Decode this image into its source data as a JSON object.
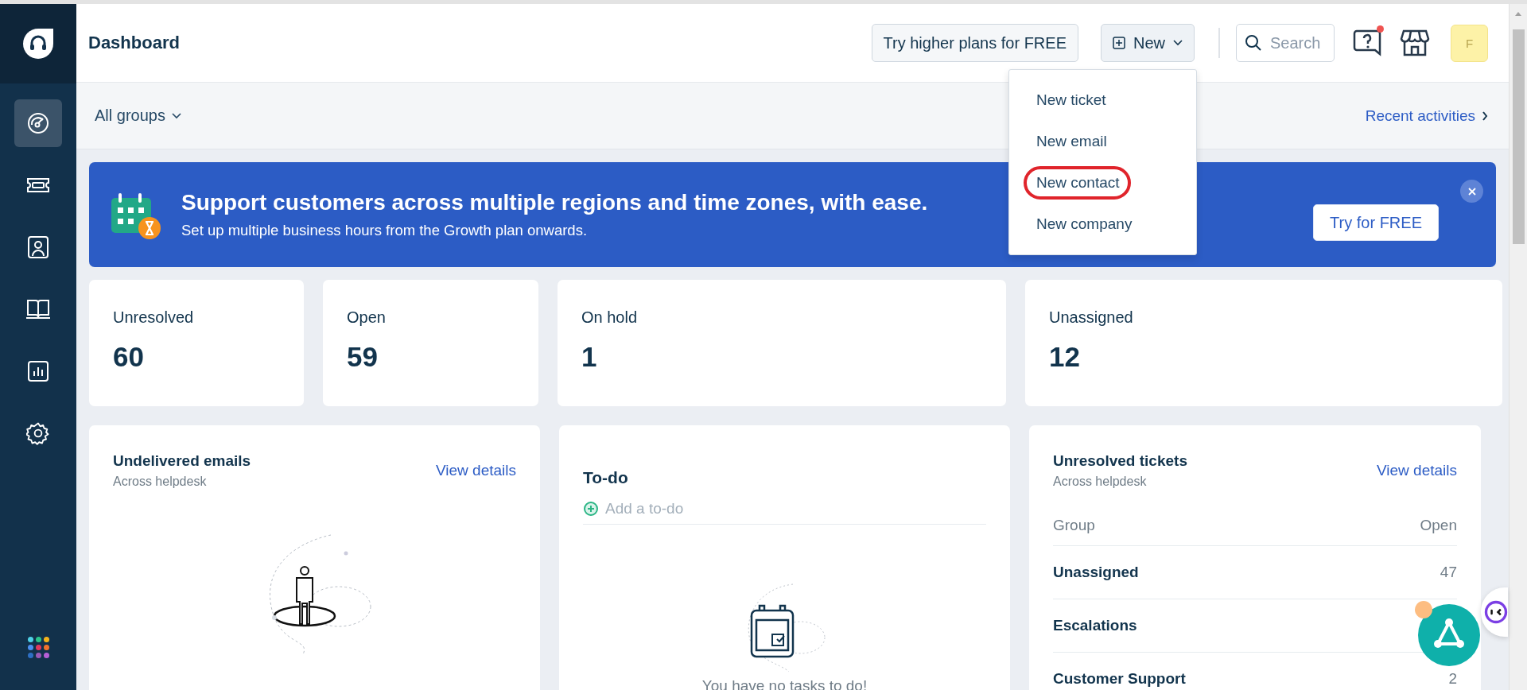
{
  "sidebar": {
    "items": [
      {
        "selected": true
      },
      {
        "selected": false
      },
      {
        "selected": false
      },
      {
        "selected": false
      },
      {
        "selected": false
      },
      {
        "selected": false
      }
    ]
  },
  "header": {
    "title": "Dashboard",
    "trial_button": "Try higher plans for FREE",
    "new_button": "New",
    "search": {
      "placeholder": "Search"
    },
    "help_notification": true,
    "avatar": "F"
  },
  "new_menu": {
    "items": [
      {
        "label": "New ticket",
        "highlighted": false
      },
      {
        "label": "New email",
        "highlighted": false
      },
      {
        "label": "New contact",
        "highlighted": true
      },
      {
        "label": "New company",
        "highlighted": false
      }
    ]
  },
  "filter_bar": {
    "group_filter": "All groups",
    "recent_link": "Recent activities"
  },
  "banner": {
    "title": "Support customers across multiple regions and time zones, with ease.",
    "subtitle": "Set up multiple business hours from the Growth plan onwards.",
    "button": "Try for FREE"
  },
  "stats": [
    {
      "label": "Unresolved",
      "value": "60"
    },
    {
      "label": "Open",
      "value": "59"
    },
    {
      "label": "On hold",
      "value": "1"
    },
    {
      "label": "Unassigned",
      "value": "12"
    }
  ],
  "undelivered": {
    "title": "Undelivered emails",
    "subtitle": "Across helpdesk",
    "link": "View details"
  },
  "todo": {
    "title": "To-do",
    "placeholder": "Add a to-do",
    "empty_text": "You have no tasks to do!"
  },
  "unresolved": {
    "title": "Unresolved tickets",
    "subtitle": "Across helpdesk",
    "link": "View details",
    "columns": [
      "Group",
      "Open"
    ],
    "rows": [
      {
        "group": "Unassigned",
        "open": "47"
      },
      {
        "group": "Escalations"
      },
      {
        "group": "Customer Support",
        "open": "2"
      }
    ]
  }
}
